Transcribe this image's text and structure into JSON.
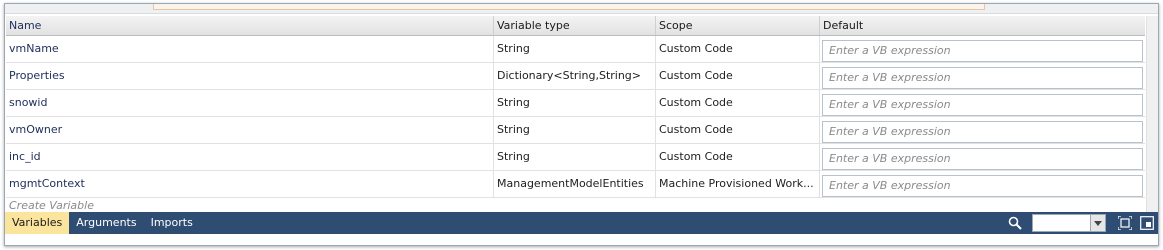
{
  "columns": {
    "name": "Name",
    "type": "Variable type",
    "scope": "Scope",
    "default": "Default"
  },
  "variables": [
    {
      "name": "vmName",
      "type": "String",
      "scope": "Custom Code"
    },
    {
      "name": "Properties",
      "type": "Dictionary<String,String>",
      "scope": "Custom Code"
    },
    {
      "name": "snowid",
      "type": "String",
      "scope": "Custom Code"
    },
    {
      "name": "vmOwner",
      "type": "String",
      "scope": "Custom Code"
    },
    {
      "name": "inc_id",
      "type": "String",
      "scope": "Custom Code"
    },
    {
      "name": "mgmtContext",
      "type": "ManagementModelEntities",
      "scope": "Machine Provisioned Work..."
    }
  ],
  "default_placeholder": "Enter a VB expression",
  "create_variable": "Create Variable",
  "tabs": [
    {
      "label": "Variables",
      "active": true
    },
    {
      "label": "Arguments",
      "active": false
    },
    {
      "label": "Imports",
      "active": false
    }
  ],
  "zoom_value": "",
  "icons": {
    "search": "search-icon",
    "dropdown": "chevron-down-icon",
    "fit": "fit-to-screen-icon",
    "overview": "overview-icon"
  },
  "colors": {
    "bottom_bar": "#2f4d73",
    "active_tab": "#fbe49c"
  }
}
